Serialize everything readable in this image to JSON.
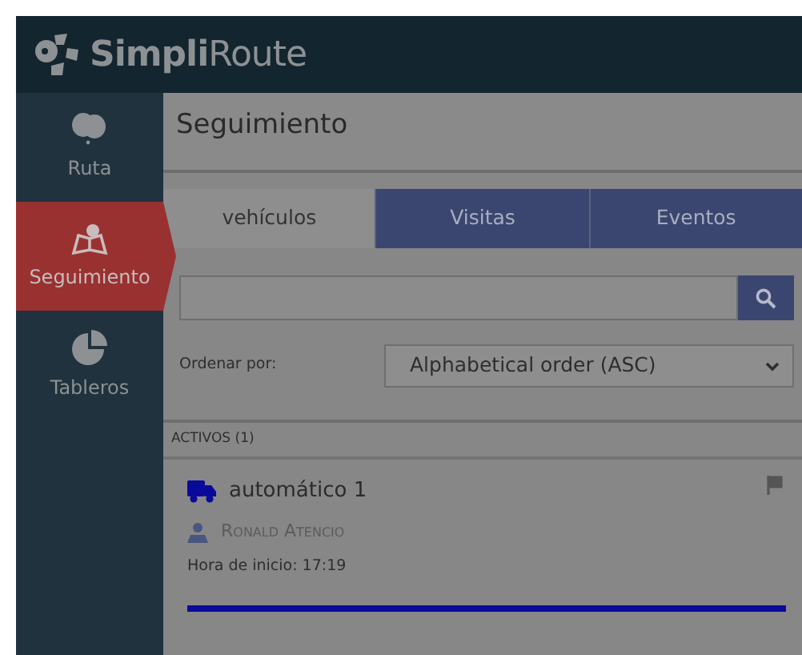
{
  "header": {
    "brand_bold": "Simpli",
    "brand_light": "Route"
  },
  "sidebar": {
    "items": [
      {
        "label": "Ruta",
        "kind": "balloons",
        "selected": false
      },
      {
        "label": "Seguimiento",
        "kind": "map",
        "selected": true
      },
      {
        "label": "Tableros",
        "kind": "chart",
        "selected": false
      }
    ]
  },
  "page": {
    "title": "Seguimiento"
  },
  "tabs": [
    {
      "label": "vehículos",
      "selected": true
    },
    {
      "label": "Visitas",
      "selected": false
    },
    {
      "label": "Eventos",
      "selected": false
    }
  ],
  "sort": {
    "label": "Ordenar por:",
    "value": "Alphabetical order (ASC)"
  },
  "section": {
    "title": "ACTIVOS (1)"
  },
  "vehicles": [
    {
      "name": "automático 1",
      "driver": "Ronald Atencio",
      "start": "Hora de inicio: 17:19"
    }
  ]
}
